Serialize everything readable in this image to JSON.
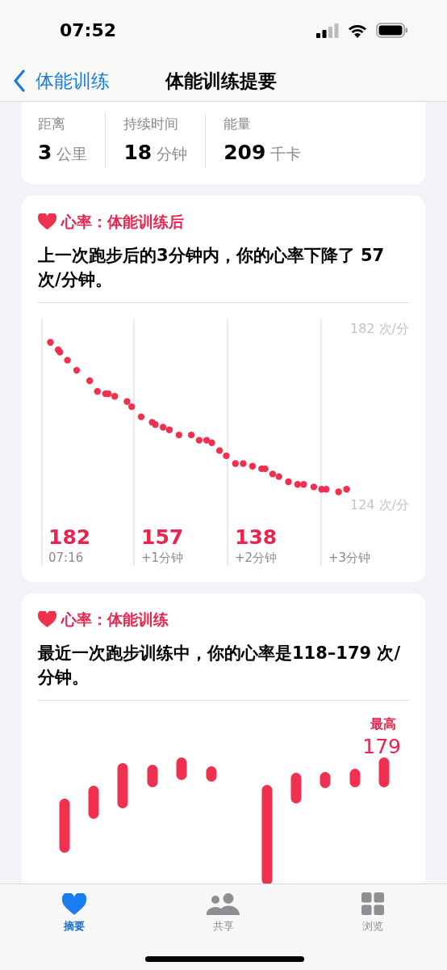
{
  "status_bar": {
    "time": "07:52"
  },
  "nav": {
    "back_label": "体能训练",
    "title": "体能训练提要"
  },
  "summary": {
    "metrics": [
      {
        "label": "距离",
        "value": "3",
        "unit": "公里"
      },
      {
        "label": "持续时间",
        "value": "18",
        "unit": "分钟"
      },
      {
        "label": "能量",
        "value": "209",
        "unit": "千卡"
      }
    ]
  },
  "recovery": {
    "title": "心率：体能训练后",
    "description": "上一次跑步后的3分钟内，你的心率下降了 57 次/分钟。",
    "chart": {
      "y_max_label": "182 次/分",
      "y_min_label": "124 次/分",
      "columns": [
        {
          "value": "182",
          "label": "07:16"
        },
        {
          "value": "157",
          "label": "+1分钟"
        },
        {
          "value": "138",
          "label": "+2分钟"
        },
        {
          "label": "+3分钟"
        }
      ]
    }
  },
  "range": {
    "title": "心率：体能训练",
    "description": "最近一次跑步训练中，你的心率是118–179 次/分钟。",
    "chart": {
      "peak_label": "最高",
      "peak_value": "179"
    }
  },
  "tab_bar": [
    {
      "label": "摘要",
      "kind": "heart",
      "selected": true
    },
    {
      "label": "共享",
      "kind": "people",
      "selected": false
    },
    {
      "label": "浏览",
      "kind": "grid",
      "selected": false
    }
  ]
}
